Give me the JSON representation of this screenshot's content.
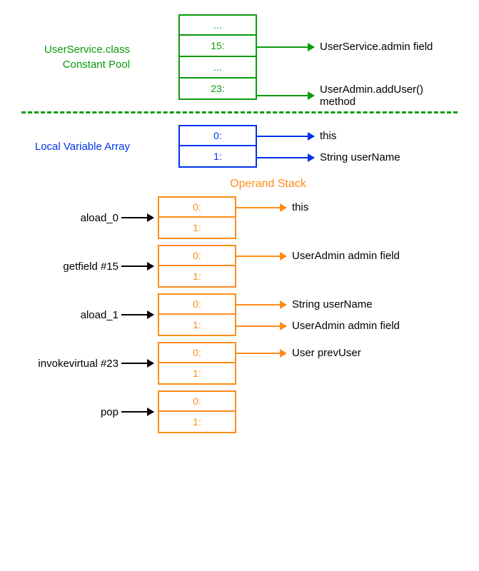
{
  "constant_pool": {
    "label": "UserService.class\nConstant Pool",
    "cells": [
      "...",
      "15:",
      "...",
      "23:"
    ],
    "refs": [
      "UserService.admin field",
      "UserAdmin.addUser() method"
    ]
  },
  "lva": {
    "label": "Local Variable Array",
    "cells": [
      "0:",
      "1:"
    ],
    "refs": [
      "this",
      "String userName"
    ]
  },
  "operand_stack": {
    "title": "Operand Stack",
    "rows": [
      {
        "op": "aload_0",
        "cells": [
          "0:",
          "1:"
        ],
        "outs": [
          "this"
        ]
      },
      {
        "op": "getfield #15",
        "cells": [
          "0:",
          "1:"
        ],
        "outs": [
          "UserAdmin admin field"
        ]
      },
      {
        "op": "aload_1",
        "cells": [
          "0:",
          "1:"
        ],
        "outs": [
          "String userName",
          "UserAdmin admin field"
        ]
      },
      {
        "op": "invokevirtual #23",
        "cells": [
          "0:",
          "1:"
        ],
        "outs": [
          "User prevUser"
        ]
      },
      {
        "op": "pop",
        "cells": [
          "0:",
          "1:"
        ],
        "outs": []
      }
    ]
  }
}
